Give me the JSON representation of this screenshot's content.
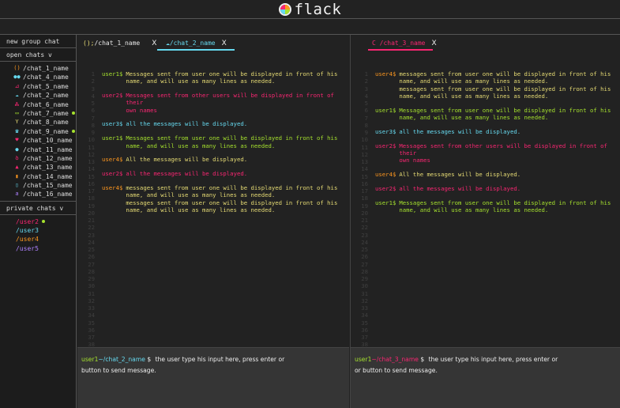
{
  "app": {
    "title": "flack"
  },
  "sidebar": {
    "new_group": "new group chat",
    "open_chats_label": "open chats v",
    "open_chats": [
      {
        "label": "/chat_1_name",
        "icon": "()",
        "color": "#fd971f"
      },
      {
        "label": "/chat_4_name",
        "icon": "●●",
        "color": "#66d9ef"
      },
      {
        "label": "/chat_5_name",
        "icon": "⊿",
        "color": "#f92672"
      },
      {
        "label": "/chat_2_name",
        "icon": "☁",
        "color": "#66d9ef"
      },
      {
        "label": "/chat_6_name",
        "icon": "Ꮬ",
        "color": "#f92672"
      },
      {
        "label": "/chat_7_name",
        "icon": "▭",
        "color": "#a6e22e",
        "online": true
      },
      {
        "label": "/chat_8_name",
        "icon": "Y",
        "color": "#e6db74"
      },
      {
        "label": "/chat_9_name",
        "icon": "☎",
        "color": "#66d9ef",
        "online": true
      },
      {
        "label": "/chat_10_name",
        "icon": "♥",
        "color": "#f92672"
      },
      {
        "label": "/chat_11_name",
        "icon": "●",
        "color": "#66d9ef"
      },
      {
        "label": "/chat_12_name",
        "icon": "ꝺ",
        "color": "#f92672"
      },
      {
        "label": "/chat_13_name",
        "icon": "▲",
        "color": "#f92672"
      },
      {
        "label": "/chat_14_name",
        "icon": "▮",
        "color": "#fd971f"
      },
      {
        "label": "/chat_15_name",
        "icon": "▯",
        "color": "#66d9ef"
      },
      {
        "label": "/chat_16_name",
        "icon": "a",
        "color": "#ae81ff"
      }
    ],
    "private_chats_label": "private chats v",
    "private_chats": [
      {
        "label": "/user2",
        "color": "#f92672",
        "online": true
      },
      {
        "label": "/user3",
        "color": "#66d9ef"
      },
      {
        "label": "/user4",
        "color": "#fd971f"
      },
      {
        "label": "/user5",
        "color": "#ae81ff"
      }
    ]
  },
  "tabs": [
    {
      "icon": "();",
      "label": "/chat_1_name",
      "close": "X"
    },
    {
      "icon": "☁",
      "label": "/chat_2_name",
      "close": "X"
    },
    {
      "icon": "C",
      "label": "/chat_3_name",
      "close": "X"
    }
  ],
  "left_chat": {
    "line_count": 38,
    "messages": [
      {
        "user": "user1$",
        "user_color": "#a6e22e",
        "text_color": "#e6db74",
        "lines": [
          "Messages sent from user one will be displayed in front of his",
          "name, and will use as many lines as needed."
        ]
      },
      {
        "user": "user2$",
        "user_color": "#f92672",
        "text_color": "#f92672",
        "lines": [
          "Messages sent from other users will be displayed in front of their",
          "own names"
        ]
      },
      {
        "user": "user3$",
        "user_color": "#66d9ef",
        "text_color": "#66d9ef",
        "lines": [
          "all the messages will be displayed."
        ]
      },
      {
        "user": "user1$",
        "user_color": "#a6e22e",
        "text_color": "#a6e22e",
        "lines": [
          "Messages sent from user one will be displayed in front of his",
          "name, and will use as many lines as needed."
        ]
      },
      {
        "user": "user4$",
        "user_color": "#fd971f",
        "text_color": "#e6db74",
        "lines": [
          "All the messages will be displayed."
        ]
      },
      {
        "user": "user2$",
        "user_color": "#f92672",
        "text_color": "#f92672",
        "lines": [
          "all the messages will be displayed."
        ]
      },
      {
        "user": "user4$",
        "user_color": "#fd971f",
        "text_color": "#e6db74",
        "lines": [
          "messages sent from user one will be displayed in front of his",
          "name, and will use as many lines as needed.",
          "messages sent from user one will be displayed in front of his",
          "name, and will use as many lines as needed."
        ]
      }
    ],
    "prompt_user": "user1",
    "prompt_path": "~/chat_2_name",
    "prompt_sym": "$",
    "input_text": "the user type his input here, press enter or",
    "input_text2": "button to send message."
  },
  "right_chat": {
    "line_count": 38,
    "messages": [
      {
        "user": "user4$",
        "user_color": "#fd971f",
        "text_color": "#e6db74",
        "lines": [
          "messages sent from user one will be displayed in front of his",
          "name, and will use as many lines as needed.",
          "messages sent from user one will be displayed in front of his",
          "name, and will use as many lines as needed."
        ]
      },
      {
        "user": "user1$",
        "user_color": "#a6e22e",
        "text_color": "#a6e22e",
        "lines": [
          "Messages sent from user one will be displayed in front of his",
          "name, and will use as many lines as needed."
        ]
      },
      {
        "user": "user3$",
        "user_color": "#66d9ef",
        "text_color": "#66d9ef",
        "lines": [
          "all the messages will be displayed."
        ]
      },
      {
        "user": "user2$",
        "user_color": "#f92672",
        "text_color": "#f92672",
        "lines": [
          "Messages sent from other users will be displayed in front of their",
          "own names"
        ]
      },
      {
        "user": "user4$",
        "user_color": "#fd971f",
        "text_color": "#e6db74",
        "lines": [
          "All the messages will be displayed."
        ]
      },
      {
        "user": "user2$",
        "user_color": "#f92672",
        "text_color": "#f92672",
        "lines": [
          "all the messages will be displayed."
        ]
      },
      {
        "user": "user1$",
        "user_color": "#a6e22e",
        "text_color": "#a6e22e",
        "lines": [
          "Messages sent from user one will be displayed in front of his",
          "name, and will use as many lines as needed."
        ]
      }
    ],
    "prompt_user": "user1",
    "prompt_path": "~/chat_3_name",
    "prompt_sym": "$",
    "input_text": "the user type his input here, press enter or",
    "input_text2": "or button to send message."
  }
}
